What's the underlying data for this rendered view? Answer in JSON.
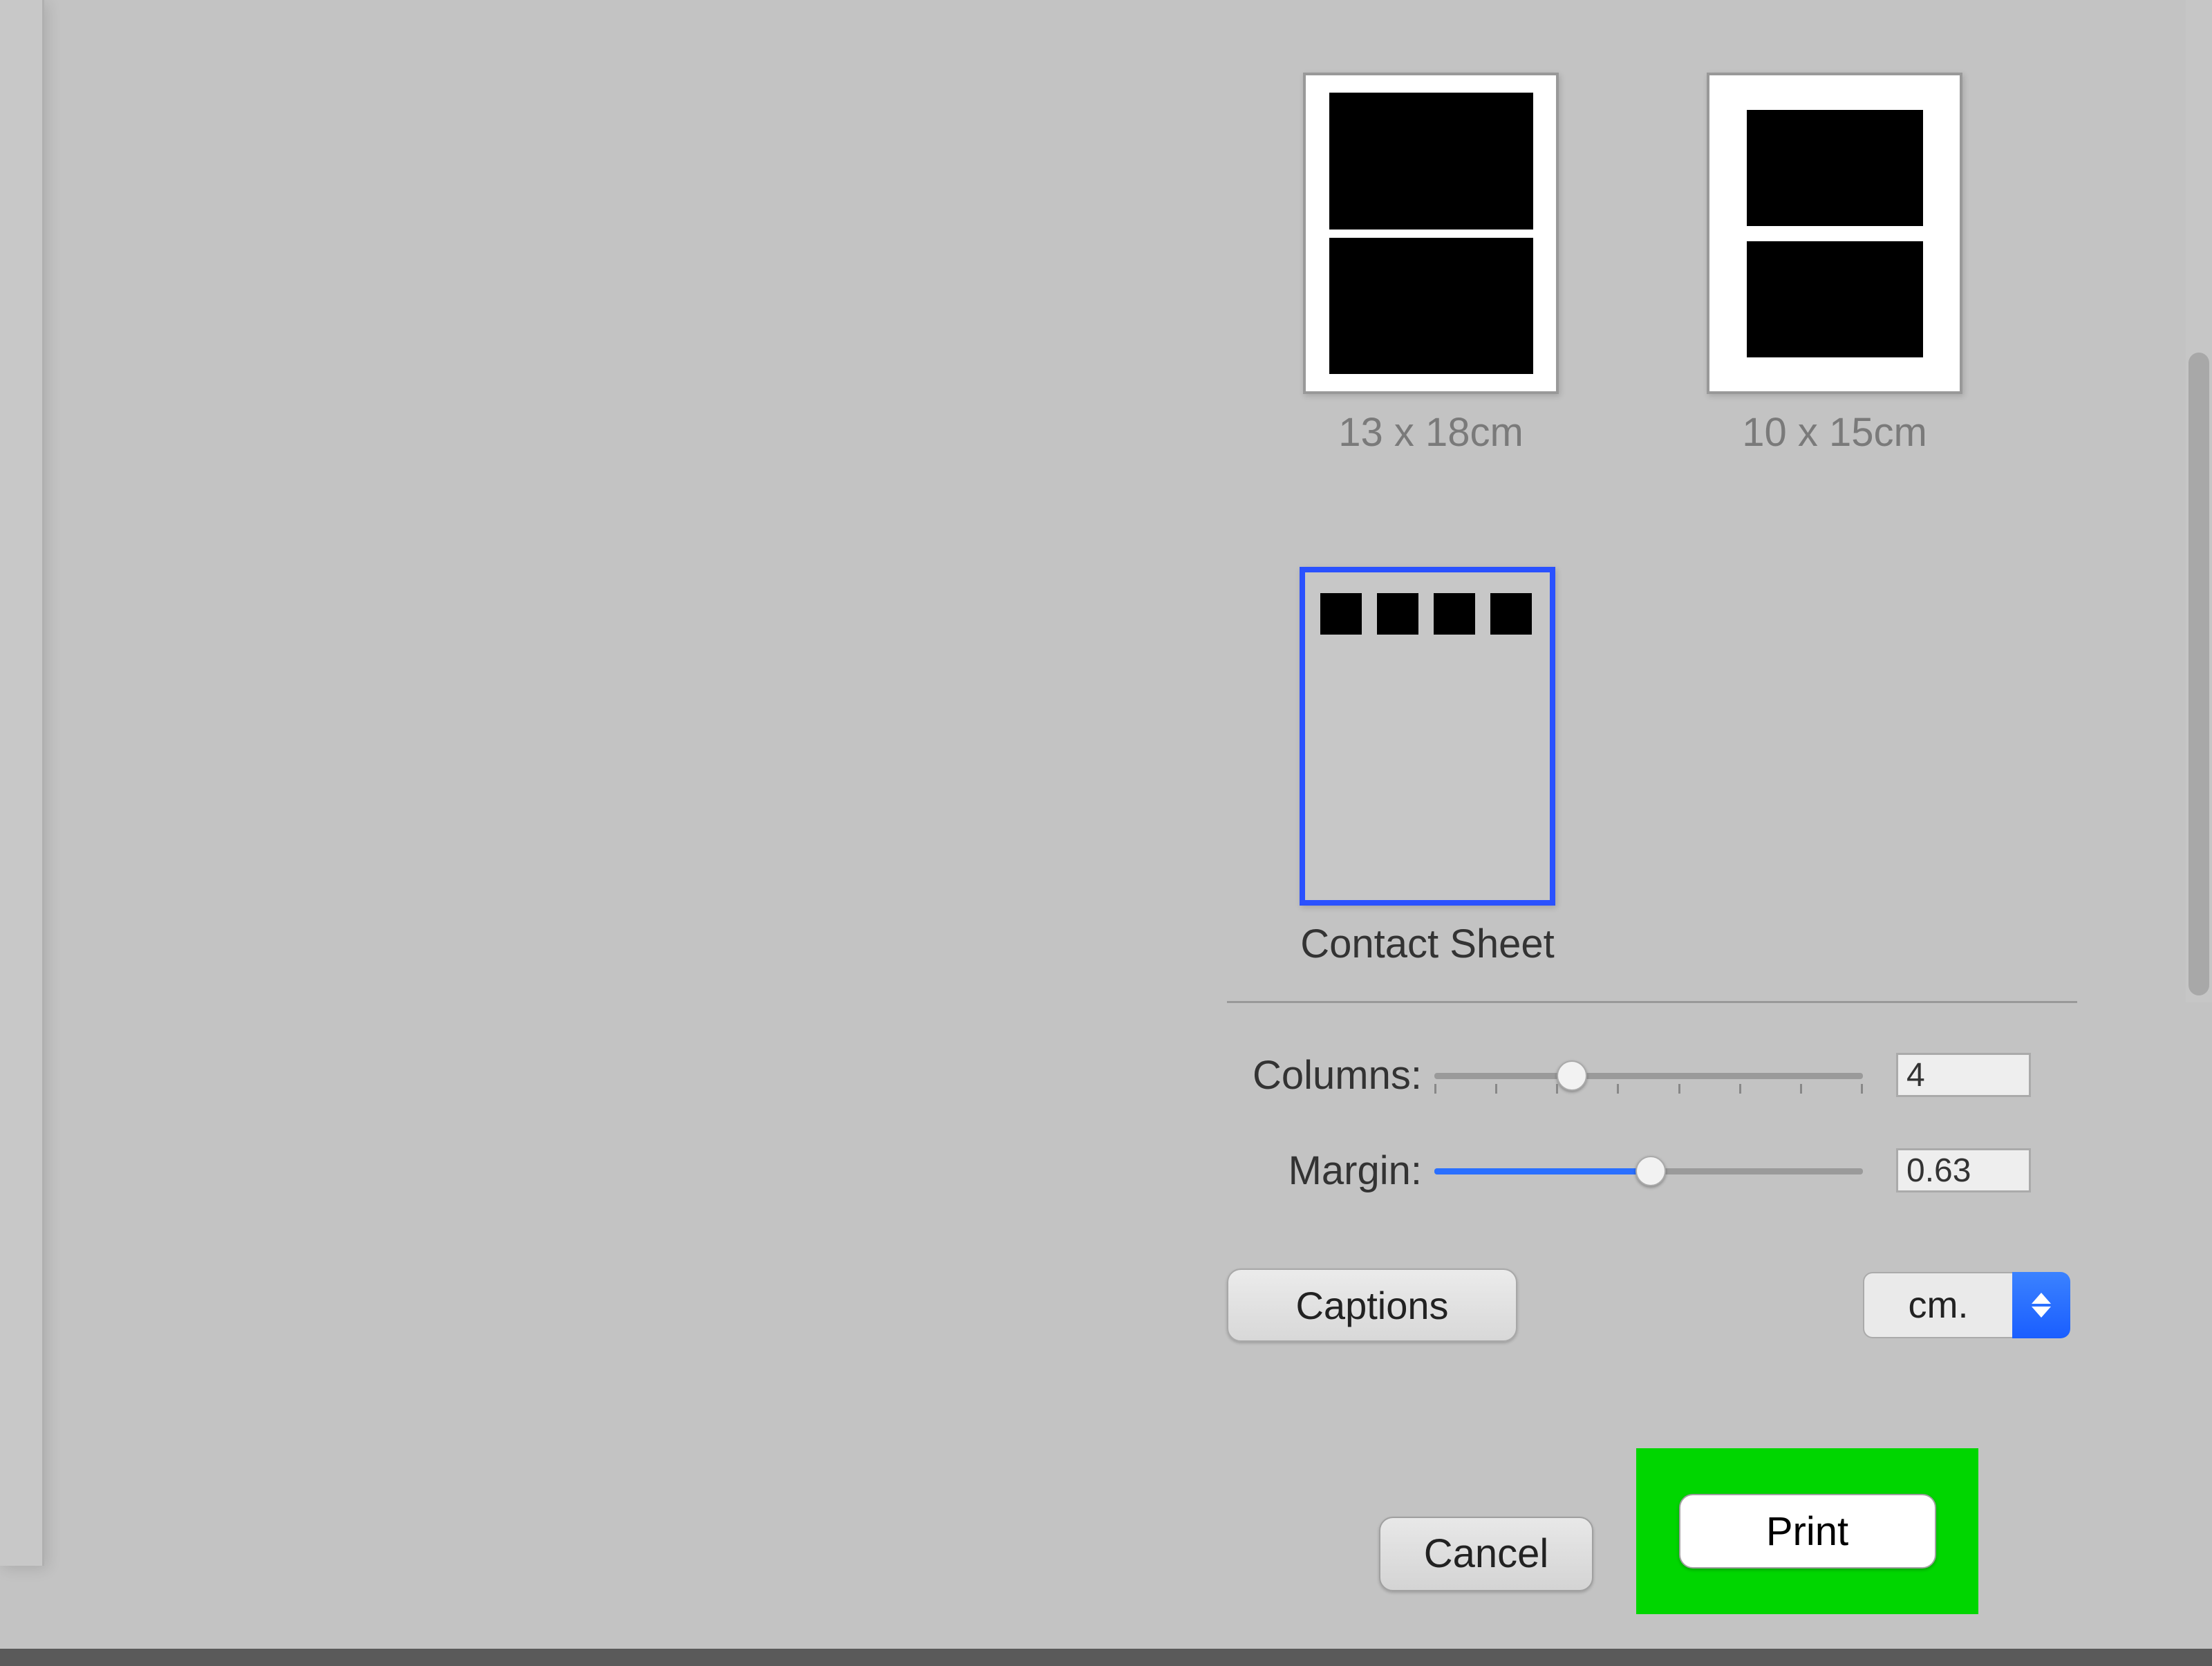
{
  "layouts": {
    "row1": [
      {
        "label": "13 x 18cm"
      },
      {
        "label": "10 x 15cm"
      }
    ],
    "row2": [
      {
        "label": "Contact Sheet",
        "selected": true
      }
    ]
  },
  "controls": {
    "columns": {
      "label": "Columns:",
      "value": "4",
      "slider_fraction": 0.3
    },
    "margin": {
      "label": "Margin:",
      "value": "0.63",
      "slider_fraction": 0.5
    }
  },
  "captions_button": "Captions",
  "unit": {
    "label": "cm."
  },
  "buttons": {
    "cancel": "Cancel",
    "print": "Print"
  },
  "colors": {
    "highlight": "#00d600",
    "selection_blue": "#2a51ff",
    "slider_blue": "#2a6fff"
  }
}
